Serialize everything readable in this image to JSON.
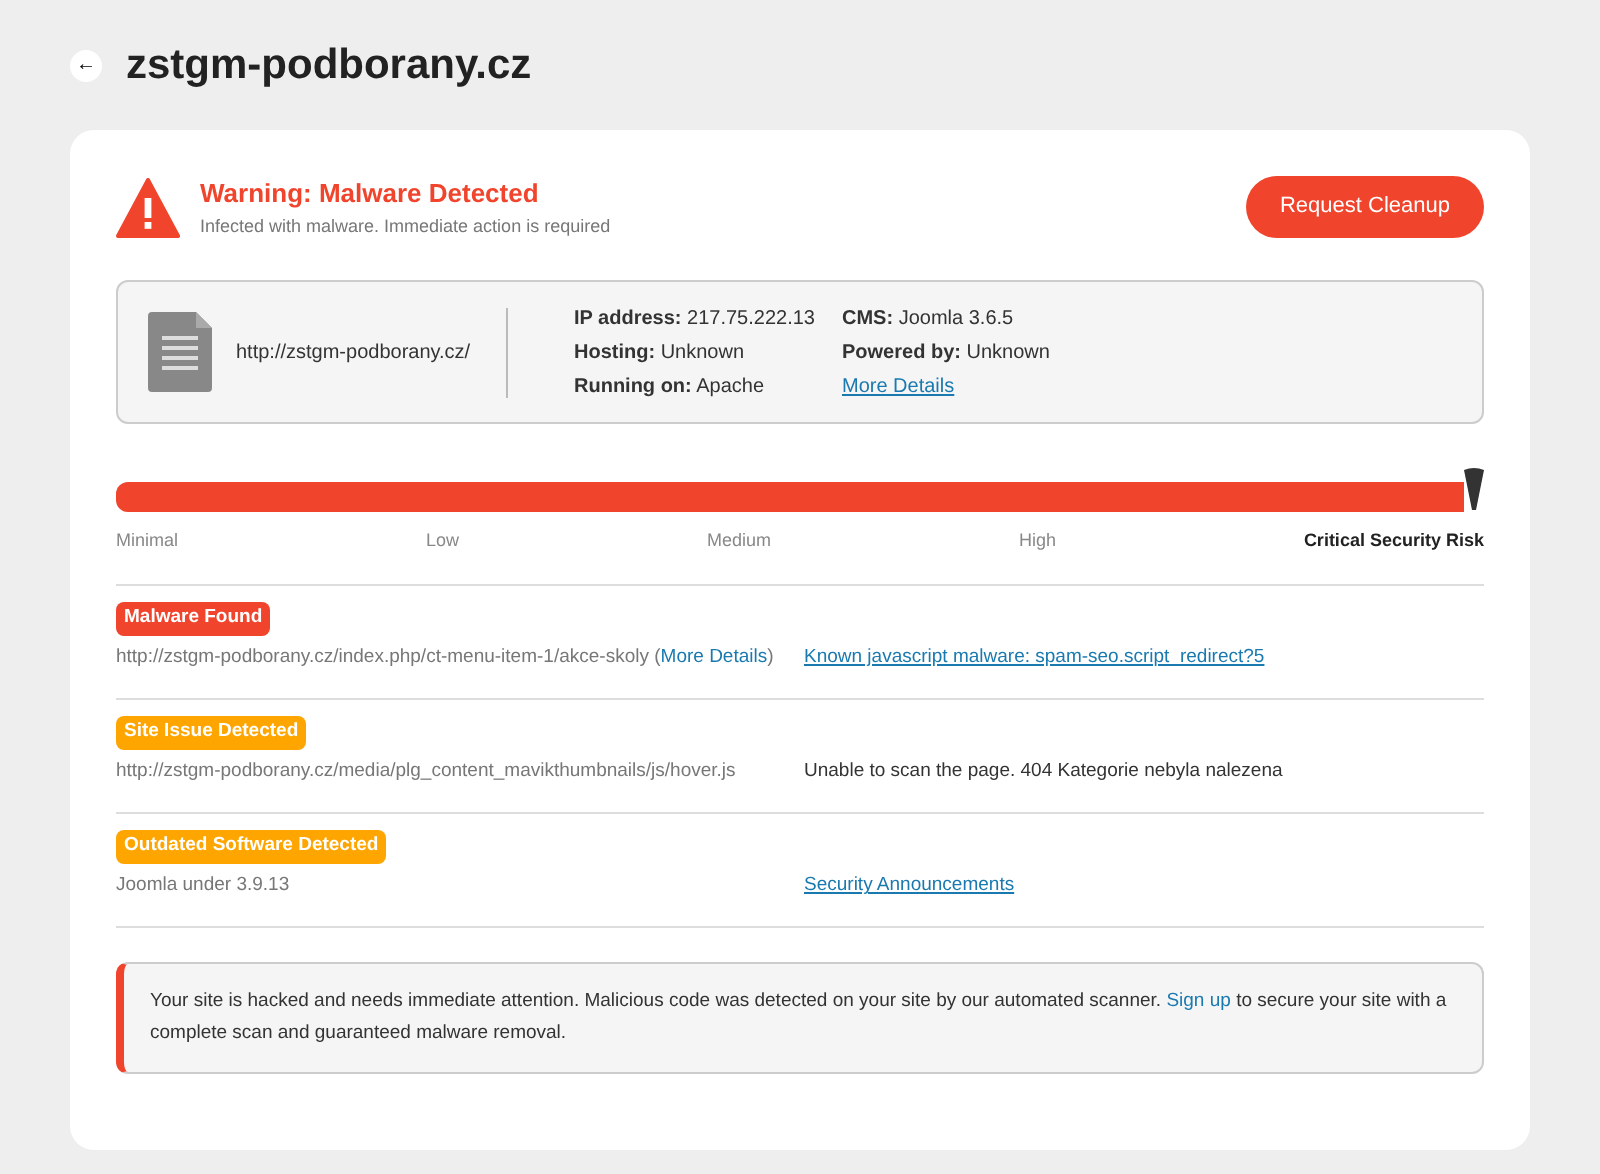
{
  "header": {
    "back_label": "←",
    "title": "zstgm-podborany.cz"
  },
  "alert": {
    "title": "Warning: Malware Detected",
    "subtitle": "Infected with malware. Immediate action is required",
    "button": "Request Cleanup"
  },
  "site_info": {
    "url": "http://zstgm-podborany.cz/",
    "fields": [
      {
        "label": "IP address:",
        "value": "217.75.222.13"
      },
      {
        "label": "Hosting:",
        "value": "Unknown"
      },
      {
        "label": "Running on:",
        "value": "Apache"
      },
      {
        "label": "CMS:",
        "value": "Joomla 3.6.5"
      },
      {
        "label": "Powered by:",
        "value": "Unknown"
      }
    ],
    "more_details": "More Details"
  },
  "risk_meter": {
    "level": 1,
    "scale": [
      {
        "label": "Minimal",
        "selected": false
      },
      {
        "label": "Low",
        "selected": false
      },
      {
        "label": "Medium",
        "selected": false
      },
      {
        "label": "High",
        "selected": false
      },
      {
        "label": "Critical Security Risk",
        "selected": true
      }
    ]
  },
  "findings": [
    {
      "badge": "Malware Found",
      "color": "#f0442c",
      "path": "http://zstgm-podborany.cz/index.php/ct-menu-item-1/akce-skoly",
      "details_open": "(",
      "details_link": "More Details",
      "details_close": ")",
      "detail": "Known javascript malware: spam-seo.script_redirect?5",
      "kind": "link"
    },
    {
      "badge": "Site Issue Detected",
      "color": "#ffa500",
      "path": "http://zstgm-podborany.cz/media/plg_content_mavikthumbnails/js/hover.js",
      "detail": "Unable to scan the page. 404 Kategorie nebyla nalezena",
      "kind": "text"
    },
    {
      "badge": "Outdated Software Detected",
      "color": "#ffa500",
      "path": "Joomla under 3.9.13",
      "detail": "Security Announcements",
      "kind": "link"
    }
  ],
  "notice": {
    "before": "Your site is hacked and needs immediate attention. Malicious code was detected on your site by our automated scanner.",
    "link": "Sign up",
    "after": "to secure your site with a complete scan and guaranteed malware removal."
  }
}
